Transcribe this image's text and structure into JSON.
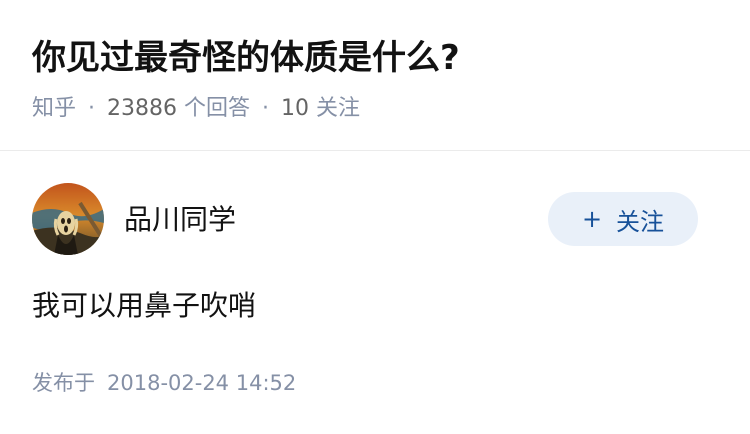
{
  "question": {
    "title": "你见过最奇怪的体质是什么?",
    "source": "知乎",
    "answer_count": "23886",
    "answer_count_label": "个回答",
    "follower_count": "10",
    "follower_label": "关注",
    "separator": "·"
  },
  "answer": {
    "author": {
      "name": "品川同学",
      "avatar_icon": "avatar-image"
    },
    "follow_button": {
      "plus": "+",
      "label": "关注"
    },
    "content": "我可以用鼻子吹哨",
    "publish_prefix": "发布于",
    "publish_time": "2018-02-24 14:52"
  },
  "colors": {
    "title": "#121212",
    "meta": "#8590a6",
    "follow_bg": "#e9f0f9",
    "follow_text": "#175199",
    "divider": "#ebebeb"
  }
}
